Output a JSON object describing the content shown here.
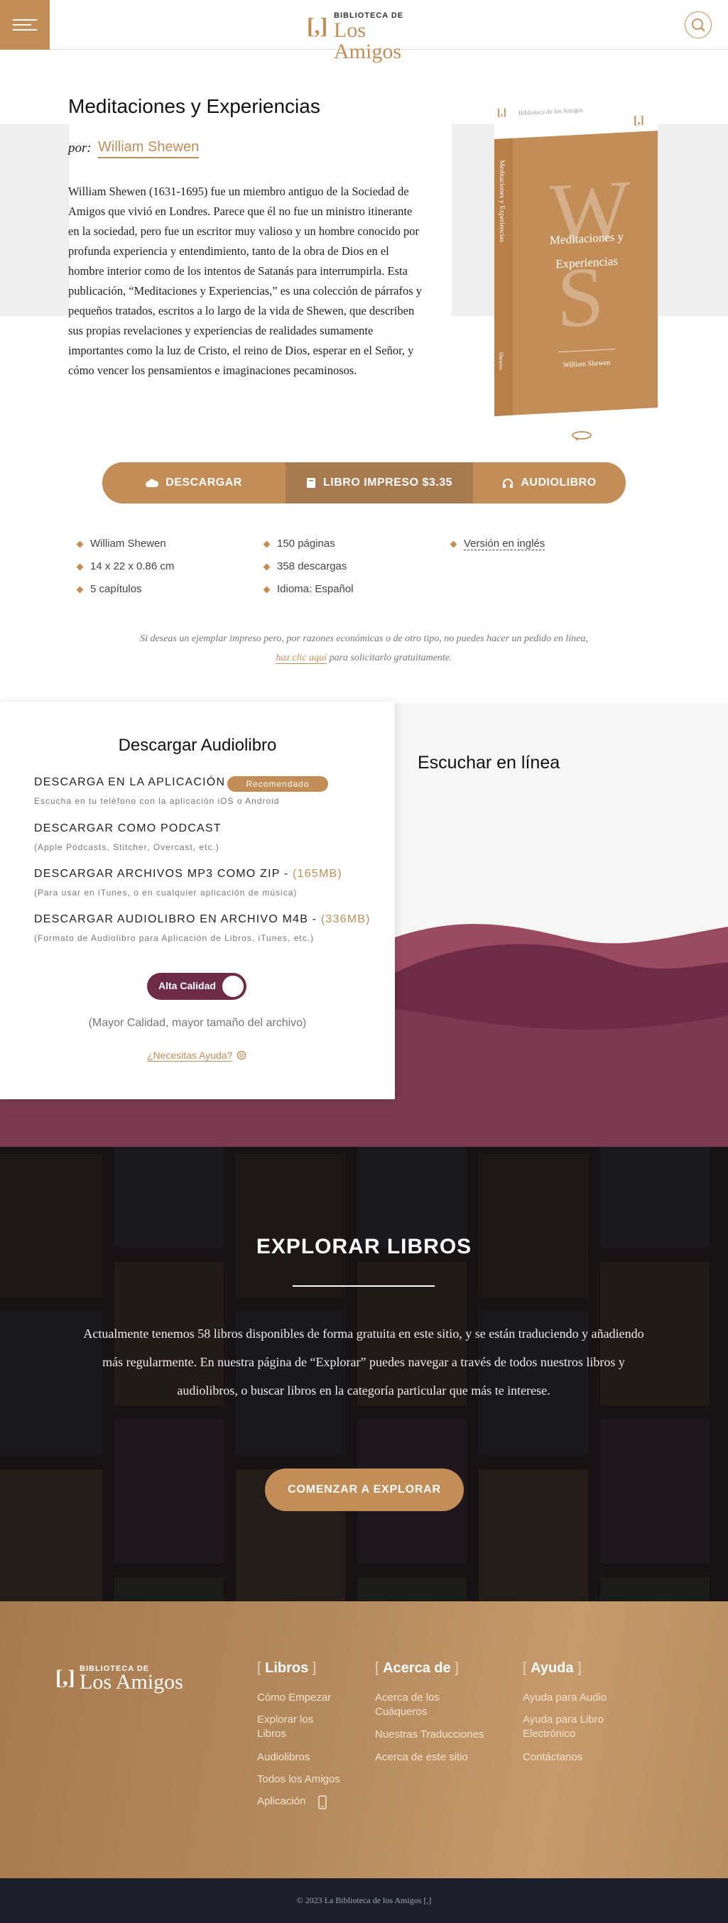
{
  "header": {
    "logo_small": "BIBLIOTECA DE",
    "logo_big": "Los Amigos",
    "logo_bracket": "[,]"
  },
  "book": {
    "title": "Meditaciones y Experiencias",
    "by_label": "por:",
    "author": "William Shewen",
    "description": "William Shewen (1631-1695) fue un miembro antiguo de la Sociedad de Amigos que vivió en Londres. Parece que él no fue un ministro itinerante en la sociedad, pero fue un escritor muy valioso y un hombre conocido por profunda experiencia y entendimiento, tanto de la obra de Dios en el hombre interior como de los intentos de Satanás para interrumpirla. Esta publicación, “Meditaciones y Experiencias,” es una colección de párrafos y pequeños tratados, escritos a lo largo de la vida de Shewen, que describen sus propias revelaciones y experiencias de realidades sumamente importantes como la luz de Cristo, el reino de Dios, esperar en el Señor, y cómo vencer los pensamientos e imaginaciones pecaminosos.",
    "cover": {
      "publisher": "Biblioteca de los Amigos",
      "title_line1": "Meditaciones y",
      "title_line2": "Experiencias",
      "author": "William Shewen",
      "letter1": "W",
      "letter2": "S",
      "spine_title": "Meditaciones y Experiencias",
      "spine_author": "Shewen"
    }
  },
  "actions": {
    "download": "DESCARGAR",
    "print": "LIBRO IMPRESO $3.35",
    "audio": "AUDIOLIBRO"
  },
  "meta": {
    "col1": [
      "William Shewen",
      "14 x 22 x 0.86 cm",
      "5 capítulos"
    ],
    "col2": [
      "150 páginas",
      "358 descargas",
      "Idioma: Español"
    ],
    "col3": [
      "Versión en inglés"
    ]
  },
  "note": {
    "text_before": "Si deseas un ejemplar impreso pero, por razones económicas o de otro tipo, no puedes hacer un pedido en línea,",
    "link": "haz clic aquí",
    "text_after": "para solicitarlo gratuitamente."
  },
  "audio": {
    "heading": "Descargar Audiolibro",
    "options": [
      {
        "label": "DESCARGA EN LA APLICACIÓN",
        "size": "",
        "sub": "Escucha en tu teléfono con la aplicación iOS o Android"
      },
      {
        "label": "DESCARGAR COMO PODCAST",
        "size": "",
        "sub": "(Apple Pódcasts, Stitcher, Overcast, etc.)"
      },
      {
        "label": "DESCARGAR ARCHIVOS MP3 COMO ZIP - ",
        "size": "(165MB)",
        "sub": "(Para usar en iTunes, o en cualquier aplicación de música)"
      },
      {
        "label": "DESCARGAR AUDIOLIBRO EN ARCHIVO M4B - ",
        "size": "(336MB)",
        "sub": "(Formato de Audiolibro para Aplicación de Libros, iTunes, etc.)"
      }
    ],
    "recommended": "Recomendado",
    "toggle_label": "Alta Calidad",
    "quality_note": "(Mayor Calidad, mayor tamaño del archivo)",
    "help": "¿Necesitas Ayuda?",
    "listen_heading": "Escuchar en línea"
  },
  "explore": {
    "title": "EXPLORAR LIBROS",
    "text": "Actualmente tenemos 58 libros disponibles de forma gratuita en este sitio, y se están traduciendo y añadiendo más regularmente. En nuestra página de “Explorar” puedes navegar a través de todos nuestros libros y audiolibros, o buscar libros en la categoría particular que más te interese.",
    "button": "COMENZAR A EXPLORAR"
  },
  "footer": {
    "columns": [
      {
        "title": "Libros",
        "links": [
          "Cómo Empezar",
          "Explorar los Libros",
          "Audiolibros",
          "Todos los Amigos",
          "Aplicación"
        ]
      },
      {
        "title": "Acerca de",
        "links": [
          "Acerca de los Cuáqueros",
          "Nuestras Traducciones",
          "Acerca de este sitio"
        ]
      },
      {
        "title": "Ayuda",
        "links": [
          "Ayuda para Audio",
          "Ayuda para Libro Electrónico",
          "Contáctanos"
        ]
      }
    ],
    "copyright": "© 2023 La Biblioteca de los Amigos [,]"
  },
  "colors": {
    "accent": "#c28d56",
    "wine": "#7b3a50",
    "dark": "#1c1e2c"
  }
}
